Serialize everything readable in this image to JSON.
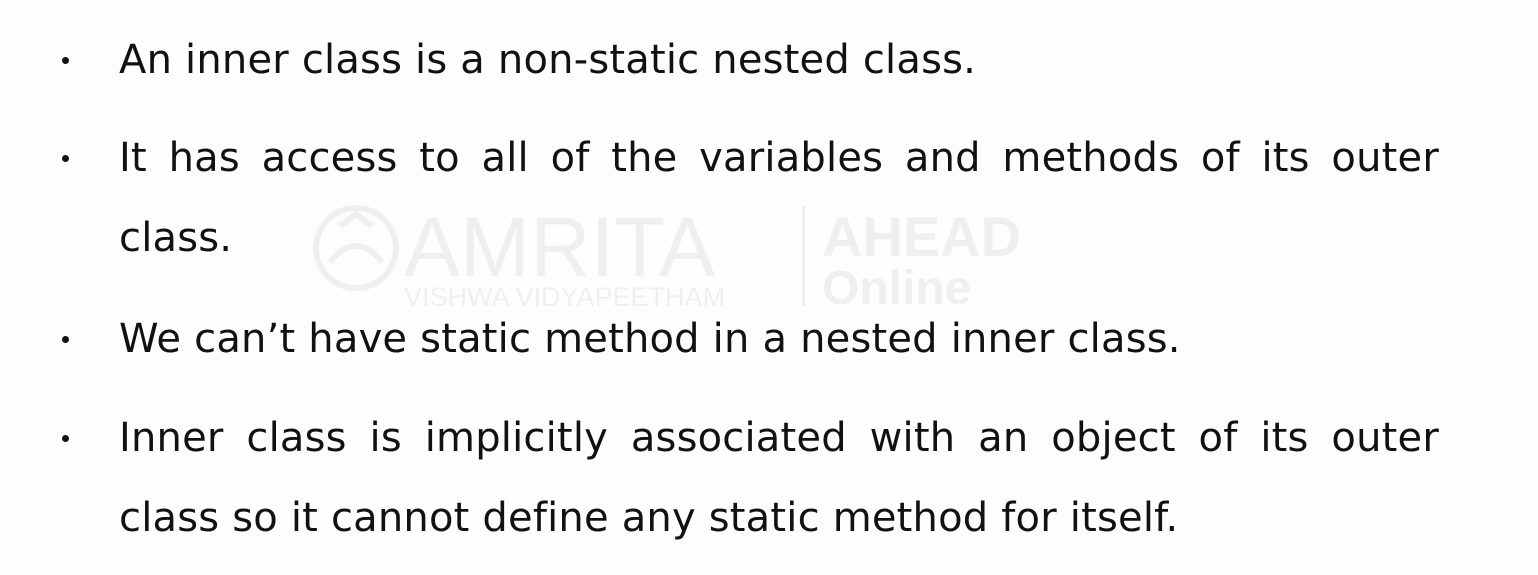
{
  "bullets": [
    {
      "text": "An inner class is a non-static nested class."
    },
    {
      "text": "It has access to all of the variables and methods of its outer class."
    },
    {
      "text": "We can’t have static method in a nested inner class."
    },
    {
      "text": "Inner class is implicitly associated with an object of its outer class so it cannot define any static method for itself."
    }
  ],
  "watermark": {
    "brand": "AMRITA",
    "subtitle": "VISHWA VIDYAPEETHAM",
    "partner_line1": "AHEAD",
    "partner_line2": "Online"
  }
}
